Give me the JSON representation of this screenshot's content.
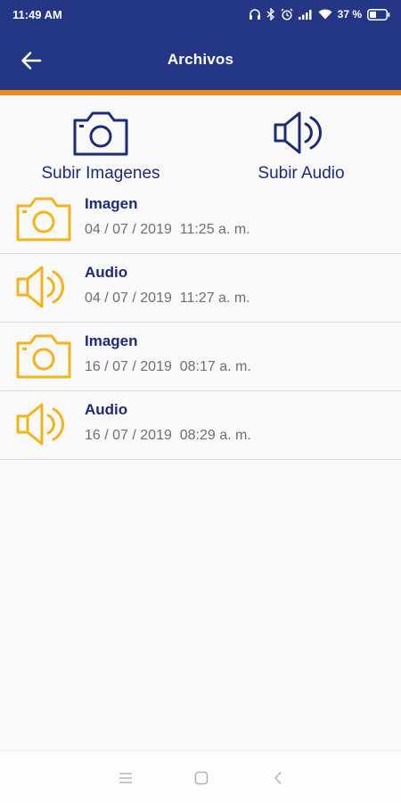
{
  "status_bar": {
    "time": "11:49 AM",
    "battery": "37 %"
  },
  "app_bar": {
    "title": "Archivos"
  },
  "actions": {
    "upload_images_label": "Subir Imagenes",
    "upload_audio_label": "Subir Audio"
  },
  "files": [
    {
      "type": "Imagen",
      "date": "04 / 07 / 2019  11:25 a. m.",
      "icon": "camera-icon"
    },
    {
      "type": "Audio",
      "date": "04 / 07 / 2019  11:27 a. m.",
      "icon": "speaker-icon"
    },
    {
      "type": "Imagen",
      "date": "16 / 07 / 2019  08:17 a. m.",
      "icon": "camera-icon"
    },
    {
      "type": "Audio",
      "date": "16 / 07 / 2019  08:29 a. m.",
      "icon": "speaker-icon"
    }
  ],
  "colors": {
    "primary": "#243785",
    "accent": "#f08a1c",
    "list_icon": "#f2b31b",
    "text_primary": "#1d2a78",
    "text_secondary": "#6f6f6f"
  }
}
